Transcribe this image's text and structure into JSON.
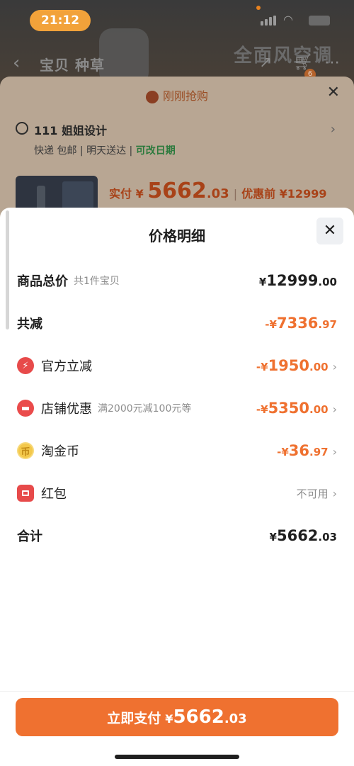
{
  "status_bar": {
    "time": "21:12"
  },
  "background_page": {
    "tabs": "宝贝  种草",
    "promo_text": "全面风空调",
    "cart_badge": "6"
  },
  "order_sheet": {
    "header": "刚刚抢购",
    "address_name": "111 姐姐设计",
    "delivery": "快递 包邮 | 明天送达",
    "change_date": "可改日期",
    "pay_label": "实付",
    "pay_currency": "¥",
    "pay_int": "5662",
    "pay_dec": ".03",
    "before_discount": "优惠前 ¥12999"
  },
  "price_detail": {
    "title": "价格明细",
    "rows": [
      {
        "label": "商品总价",
        "sub": "共1件宝贝",
        "cur": "¥",
        "int": "12999",
        "dec": ".00"
      },
      {
        "label": "共减",
        "cur": "-¥",
        "int": "7336",
        "dec": ".97"
      },
      {
        "label": "官方立减",
        "cur": "-¥",
        "int": "1950",
        "dec": ".00"
      },
      {
        "label": "店铺优惠",
        "sub": "满2000元减100元等",
        "cur": "-¥",
        "int": "5350",
        "dec": ".00"
      },
      {
        "label": "淘金币",
        "cur": "-¥",
        "int": "36",
        "dec": ".97"
      },
      {
        "label": "红包",
        "value": "不可用"
      },
      {
        "label": "合计",
        "cur": "¥",
        "int": "5662",
        "dec": ".03"
      }
    ]
  },
  "bottom": {
    "button_label": "立即支付",
    "cur": "¥",
    "int": "5662",
    "dec": ".03"
  },
  "colors": {
    "accent": "#ef7130",
    "status_pill": "#f2a23a",
    "green_text": "#2b7a3d"
  },
  "icons": [
    "lightning-icon",
    "store-icon",
    "coin-icon",
    "red-packet-icon",
    "location-icon",
    "close-icon",
    "chevron-right-icon"
  ]
}
